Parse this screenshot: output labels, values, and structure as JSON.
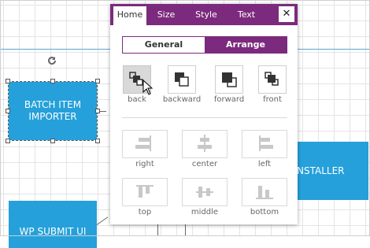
{
  "canvas": {
    "nodes": [
      {
        "label_line1": "BATCH ITEM",
        "label_line2": "IMPORTER"
      },
      {
        "label": "NSTALLER"
      },
      {
        "label": "WP SUBMIT UI"
      }
    ],
    "accent_color": "#25a0da"
  },
  "panel": {
    "tabs": [
      "Home",
      "Size",
      "Style",
      "Text"
    ],
    "active_tab": "Home",
    "close_label": "✕",
    "segment": {
      "general_label": "General",
      "arrange_label": "Arrange",
      "selected": "Arrange"
    },
    "order_buttons": [
      {
        "label": "back",
        "icon": "send-to-back-icon",
        "pressed": true
      },
      {
        "label": "backward",
        "icon": "send-backward-icon"
      },
      {
        "label": "forward",
        "icon": "bring-forward-icon"
      },
      {
        "label": "front",
        "icon": "bring-to-front-icon"
      }
    ],
    "align_buttons": [
      {
        "label": "right",
        "icon": "align-top-rows-icon"
      },
      {
        "label": "center",
        "icon": "align-center-icon"
      },
      {
        "label": "left",
        "icon": "align-left-rows-icon"
      },
      {
        "label": "top",
        "icon": "align-top-icon"
      },
      {
        "label": "middle",
        "icon": "align-middle-icon"
      },
      {
        "label": "bottom",
        "icon": "align-bottom-icon"
      }
    ],
    "brand_color": "#7b2a7d"
  }
}
